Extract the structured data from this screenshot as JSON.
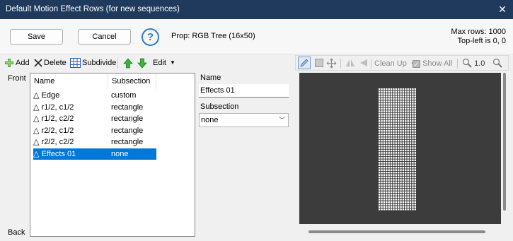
{
  "window": {
    "title": "Default Motion Effect Rows (for new sequences)",
    "close_glyph": "✕"
  },
  "topbar": {
    "save_label": "Save",
    "cancel_label": "Cancel",
    "help_glyph": "?",
    "prop_label": "Prop: RGB Tree (16x50)",
    "max_rows": "Max rows: 1000",
    "top_left": "Top-left is 0, 0"
  },
  "toolbar": {
    "add_label": "Add",
    "delete_label": "Delete",
    "subdivide_label": "Subdivide",
    "edit_label": "Edit"
  },
  "sidebar": {
    "front_label": "Front",
    "back_label": "Back"
  },
  "list": {
    "columns": [
      "Name",
      "Subsection"
    ],
    "rows": [
      {
        "name": "Edge",
        "subsection": "custom"
      },
      {
        "name": "r1/2, c1/2",
        "subsection": "rectangle"
      },
      {
        "name": "r1/2, c2/2",
        "subsection": "rectangle"
      },
      {
        "name": "r2/2, c1/2",
        "subsection": "rectangle"
      },
      {
        "name": "r2/2, c2/2",
        "subsection": "rectangle"
      },
      {
        "name": "Effects 01",
        "subsection": "none"
      }
    ],
    "row_icon": "triangle-icon"
  },
  "props": {
    "name_label": "Name",
    "name_value": "Effects 01",
    "subsection_label": "Subsection",
    "subsection_value": "none"
  },
  "editor_toolbar": {
    "cleanup_label": "Clean Up",
    "show_all_label": "Show All",
    "zoom_value": "1.0"
  },
  "colors": {
    "titlebar": "#1f3a5c",
    "selection": "#0078d7",
    "canvas": "#3c3c3c",
    "add_green": "#3a9a2a",
    "arrow_green": "#3cb43c"
  }
}
